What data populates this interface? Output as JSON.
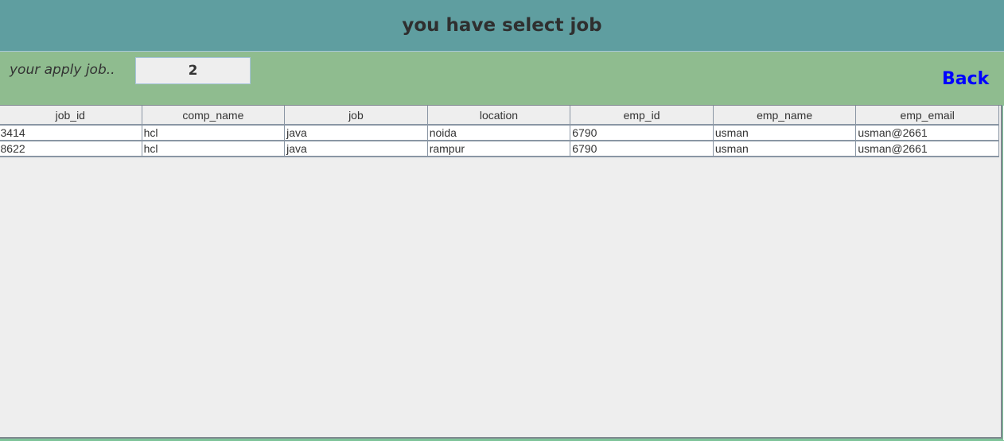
{
  "header": {
    "title": "you have select job"
  },
  "apply": {
    "label": "your apply job..",
    "count": "2",
    "back_label": "Back"
  },
  "table": {
    "columns": [
      "job_id",
      "comp_name",
      "job",
      "location",
      "emp_id",
      "emp_name",
      "emp_email"
    ],
    "rows": [
      [
        "3414",
        "hcl",
        "java",
        "noida",
        "6790",
        "usman",
        "usman@2661"
      ],
      [
        "8622",
        "hcl",
        "java",
        "rampur",
        "6790",
        "usman",
        "usman@2661"
      ]
    ]
  }
}
